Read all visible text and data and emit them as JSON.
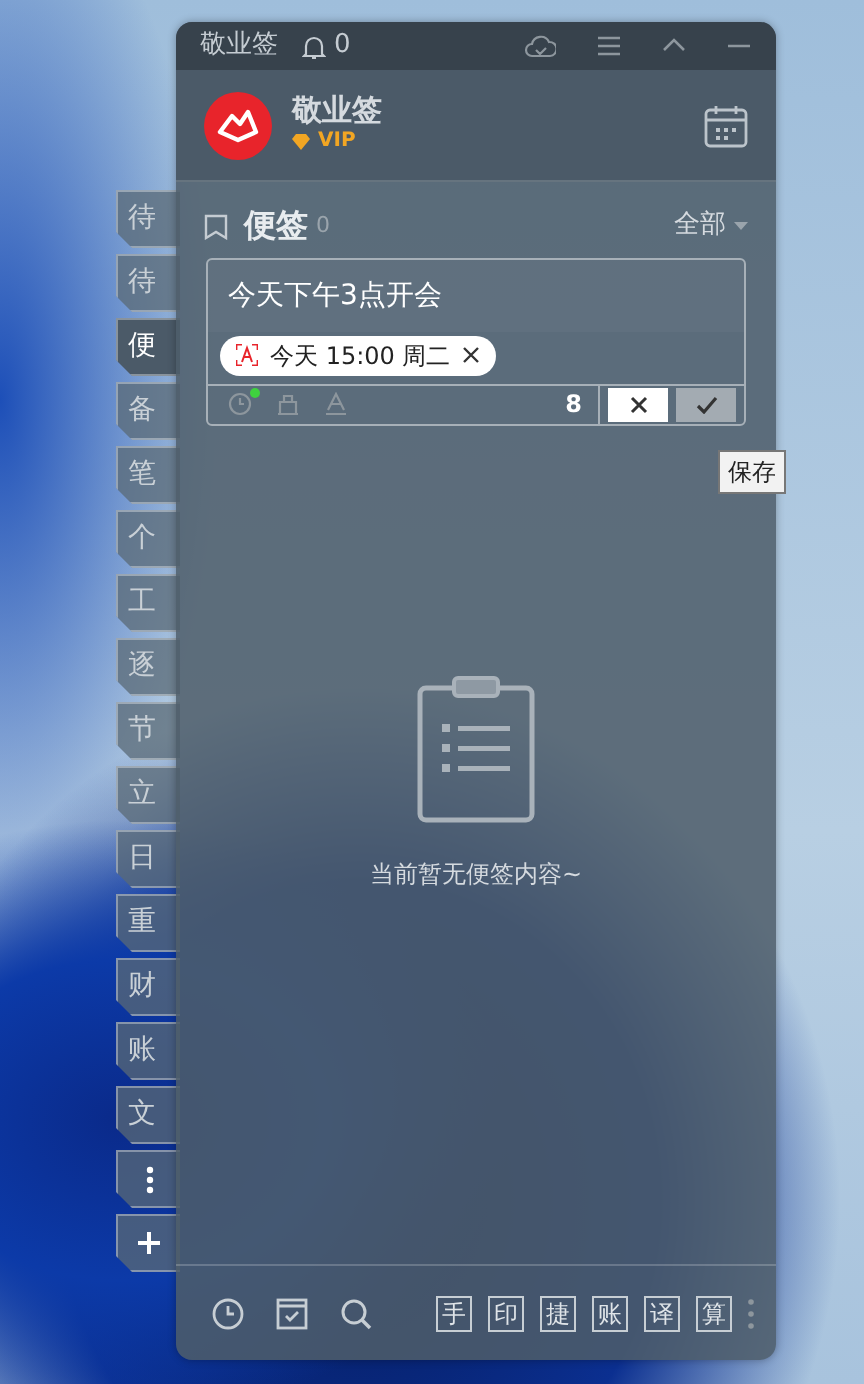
{
  "title_bar": {
    "app_name": "敬业签",
    "bell_count": "0"
  },
  "profile": {
    "name": "敬业签",
    "badge": "VIP"
  },
  "side_tabs": [
    {
      "label": "待",
      "selected": false
    },
    {
      "label": "待",
      "selected": false
    },
    {
      "label": "便",
      "selected": true
    },
    {
      "label": "备",
      "selected": false
    },
    {
      "label": "笔",
      "selected": false
    },
    {
      "label": "个",
      "selected": false
    },
    {
      "label": "工",
      "selected": false
    },
    {
      "label": "逐",
      "selected": false
    },
    {
      "label": "节",
      "selected": false
    },
    {
      "label": "立",
      "selected": false
    },
    {
      "label": "日",
      "selected": false
    },
    {
      "label": "重",
      "selected": false
    },
    {
      "label": "财",
      "selected": false
    },
    {
      "label": "账",
      "selected": false
    },
    {
      "label": "文",
      "selected": false
    }
  ],
  "notes_header": {
    "title": "便签",
    "count": "0",
    "filter": "全部"
  },
  "editor": {
    "text": "今天下午3点开会",
    "reminder": "今天 15:00 周二",
    "reminder_set": true,
    "char_count": "8"
  },
  "tooltip": "保存",
  "empty_state": "当前暂无便签内容~",
  "tool_buttons": [
    "手",
    "印",
    "捷",
    "账",
    "译",
    "算"
  ]
}
